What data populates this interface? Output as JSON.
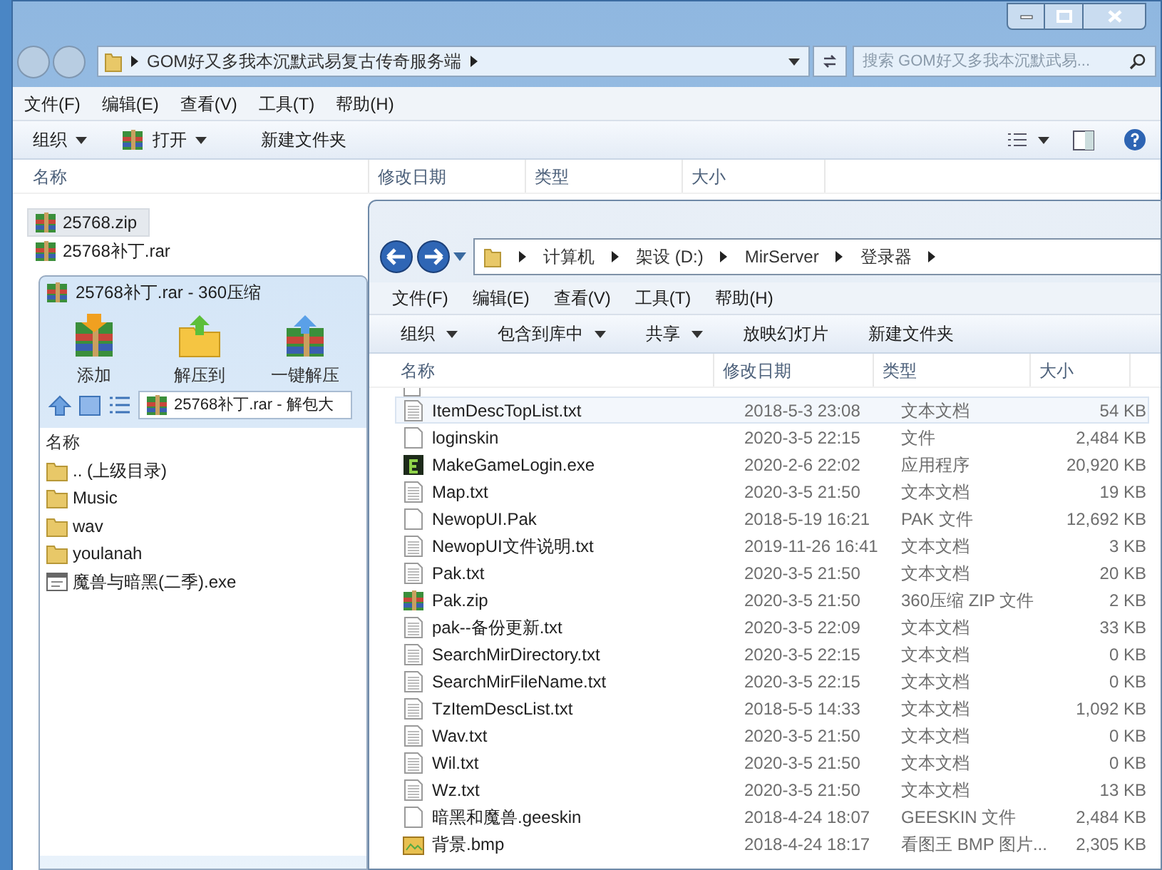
{
  "back_window": {
    "address": {
      "crumbs": [
        "GOM好又多我本沉默武易复古传奇服务端"
      ]
    },
    "search": {
      "placeholder": "搜索 GOM好又多我本沉默武易..."
    },
    "menu": [
      "文件(F)",
      "编辑(E)",
      "查看(V)",
      "工具(T)",
      "帮助(H)"
    ],
    "toolbar": [
      {
        "label": "组织",
        "dropdown": true,
        "kind": "plain"
      },
      {
        "label": "打开",
        "dropdown": true,
        "kind": "open"
      },
      {
        "label": "新建文件夹",
        "dropdown": false,
        "kind": "plain"
      }
    ],
    "columns": [
      "名称",
      "修改日期",
      "类型",
      "大小"
    ],
    "files": [
      {
        "name": "25768.zip",
        "selected": true
      },
      {
        "name": "25768补丁.rar",
        "selected": false
      }
    ]
  },
  "zip_window": {
    "title": "25768补丁.rar - 360压缩",
    "tools": [
      {
        "label": "添加",
        "kind": "add"
      },
      {
        "label": "解压到",
        "kind": "extract"
      },
      {
        "label": "一键解压",
        "kind": "oneclick"
      }
    ],
    "path": "25768补丁.rar - 解包大",
    "column": "名称",
    "items": [
      {
        "name": ".. (上级目录)",
        "kind": "folder"
      },
      {
        "name": "Music",
        "kind": "folder"
      },
      {
        "name": "wav",
        "kind": "folder"
      },
      {
        "name": "youlanah",
        "kind": "folder"
      },
      {
        "name": "魔兽与暗黑(二季).exe",
        "kind": "exe"
      }
    ]
  },
  "front_window": {
    "crumbs": [
      "计算机",
      "架设 (D:)",
      "MirServer",
      "登录器"
    ],
    "menu": [
      "文件(F)",
      "编辑(E)",
      "查看(V)",
      "工具(T)",
      "帮助(H)"
    ],
    "toolbar": [
      {
        "label": "组织",
        "dropdown": true
      },
      {
        "label": "包含到库中",
        "dropdown": true
      },
      {
        "label": "共享",
        "dropdown": true
      },
      {
        "label": "放映幻灯片",
        "dropdown": false
      },
      {
        "label": "新建文件夹",
        "dropdown": false
      }
    ],
    "columns": [
      "名称",
      "修改日期",
      "类型",
      "大小"
    ],
    "files": [
      {
        "name": "ItemDescTopList.txt",
        "modified": "2018-5-3 23:08",
        "type": "文本文档",
        "size": "54 KB",
        "kind": "txt",
        "selected": true
      },
      {
        "name": "loginskin",
        "modified": "2020-3-5 22:15",
        "type": "文件",
        "size": "2,484 KB",
        "kind": "file",
        "selected": false
      },
      {
        "name": "MakeGameLogin.exe",
        "modified": "2020-2-6 22:02",
        "type": "应用程序",
        "size": "20,920 KB",
        "kind": "exe",
        "selected": false
      },
      {
        "name": "Map.txt",
        "modified": "2020-3-5 21:50",
        "type": "文本文档",
        "size": "19 KB",
        "kind": "txt",
        "selected": false
      },
      {
        "name": "NewopUI.Pak",
        "modified": "2018-5-19 16:21",
        "type": "PAK 文件",
        "size": "12,692 KB",
        "kind": "file",
        "selected": false
      },
      {
        "name": "NewopUI文件说明.txt",
        "modified": "2019-11-26 16:41",
        "type": "文本文档",
        "size": "3 KB",
        "kind": "txt",
        "selected": false
      },
      {
        "name": "Pak.txt",
        "modified": "2020-3-5 21:50",
        "type": "文本文档",
        "size": "20 KB",
        "kind": "txt",
        "selected": false
      },
      {
        "name": "Pak.zip",
        "modified": "2020-3-5 21:50",
        "type": "360压缩 ZIP 文件",
        "size": "2 KB",
        "kind": "zip",
        "selected": false
      },
      {
        "name": "pak--备份更新.txt",
        "modified": "2020-3-5 22:09",
        "type": "文本文档",
        "size": "33 KB",
        "kind": "txt",
        "selected": false
      },
      {
        "name": "SearchMirDirectory.txt",
        "modified": "2020-3-5 22:15",
        "type": "文本文档",
        "size": "0 KB",
        "kind": "txt",
        "selected": false
      },
      {
        "name": "SearchMirFileName.txt",
        "modified": "2020-3-5 22:15",
        "type": "文本文档",
        "size": "0 KB",
        "kind": "txt",
        "selected": false
      },
      {
        "name": "TzItemDescList.txt",
        "modified": "2018-5-5 14:33",
        "type": "文本文档",
        "size": "1,092 KB",
        "kind": "txt",
        "selected": false
      },
      {
        "name": "Wav.txt",
        "modified": "2020-3-5 21:50",
        "type": "文本文档",
        "size": "0 KB",
        "kind": "txt",
        "selected": false
      },
      {
        "name": "Wil.txt",
        "modified": "2020-3-5 21:50",
        "type": "文本文档",
        "size": "0 KB",
        "kind": "txt",
        "selected": false
      },
      {
        "name": "Wz.txt",
        "modified": "2020-3-5 21:50",
        "type": "文本文档",
        "size": "13 KB",
        "kind": "txt",
        "selected": false
      },
      {
        "name": "暗黑和魔兽.geeskin",
        "modified": "2018-4-24 18:07",
        "type": "GEESKIN 文件",
        "size": "2,484 KB",
        "kind": "file",
        "selected": false
      },
      {
        "name": "背景.bmp",
        "modified": "2018-4-24 18:17",
        "type": "看图王 BMP 图片...",
        "size": "2,305 KB",
        "kind": "bmp",
        "selected": false
      }
    ]
  }
}
